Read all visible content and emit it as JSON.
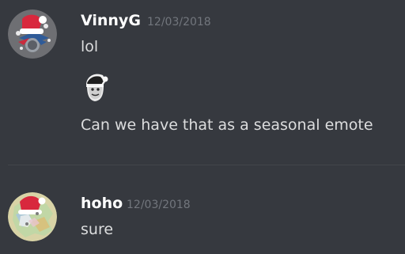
{
  "messages": [
    {
      "username": "VinnyG",
      "timestamp": "12/03/2018",
      "lines": [
        "lol",
        "Can we have that as a seasonal emote"
      ],
      "emote": "santa-hat-face-emote",
      "avatar": "santa-hat-logo-avatar"
    },
    {
      "username": "hoho",
      "timestamp": "12/03/2018",
      "lines": [
        "sure"
      ],
      "avatar": "santa-hat-map-avatar"
    }
  ],
  "colors": {
    "background": "#36393f",
    "username": "#ffffff",
    "timestamp": "#72767d",
    "text": "#dcddde",
    "divider": "#42454a"
  }
}
